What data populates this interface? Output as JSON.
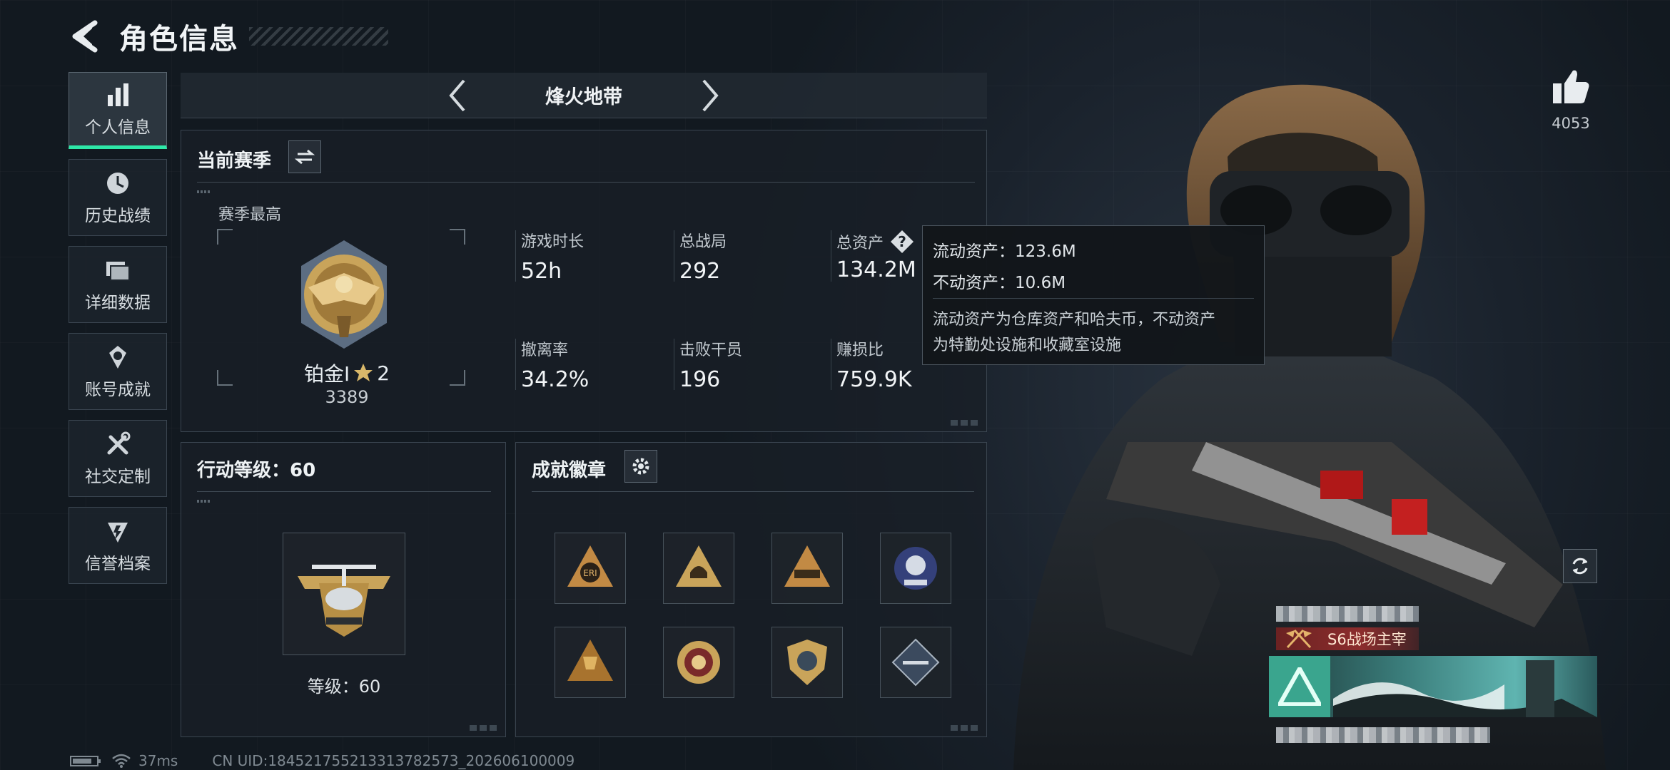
{
  "header": {
    "title": "角色信息"
  },
  "nav": {
    "items": [
      {
        "label": "个人信息",
        "icon": "bar-chart-icon",
        "active": true
      },
      {
        "label": "历史战绩",
        "icon": "history-clock-icon",
        "active": false
      },
      {
        "label": "详细数据",
        "icon": "folder-icon",
        "active": false
      },
      {
        "label": "账号成就",
        "icon": "achievement-medal-icon",
        "active": false
      },
      {
        "label": "社交定制",
        "icon": "tools-icon",
        "active": false
      },
      {
        "label": "信誉档案",
        "icon": "credit-shield-icon",
        "active": false
      }
    ]
  },
  "mode": {
    "title": "烽火地带"
  },
  "season": {
    "title": "当前赛季",
    "best_label": "赛季最高",
    "rank_name": "铂金Ⅰ",
    "rank_stars": "2",
    "rank_score": "3389",
    "stats": [
      {
        "label": "游戏时长",
        "value": "52h"
      },
      {
        "label": "总战局",
        "value": "292"
      },
      {
        "label": "总资产",
        "value": "134.2M"
      },
      {
        "label": "撤离率",
        "value": "34.2%"
      },
      {
        "label": "击败干员",
        "value": "196"
      },
      {
        "label": "赚损比",
        "value": "759.9K"
      }
    ]
  },
  "tooltip": {
    "liquid": "流动资产：123.6M",
    "fixed": "不动资产：10.6M",
    "note_line1": "流动资产为仓库资产和哈夫币，不动资产",
    "note_line2": "为特勤处设施和收藏室设施"
  },
  "level": {
    "title": "行动等级：60",
    "caption": "等级：60"
  },
  "badges": {
    "title": "成就徽章",
    "items": [
      "badge-eri-icon",
      "badge-triangle-helmet-icon",
      "badge-triangle-vehicle-icon",
      "badge-round-blue-icon",
      "badge-triangle-trophy-icon",
      "badge-round-gold-icon",
      "badge-shield-gold-icon",
      "badge-diamond-rifle-icon"
    ]
  },
  "right": {
    "like_count": "4053",
    "player_title": "S6战场主宰"
  },
  "status": {
    "ping": "37ms",
    "uid": "CN UID:184521755213313782573_202606100009"
  },
  "colors": {
    "accent": "#2ee8a8",
    "gold": "#c9a45a",
    "tooltip_bg": "#12161a"
  }
}
